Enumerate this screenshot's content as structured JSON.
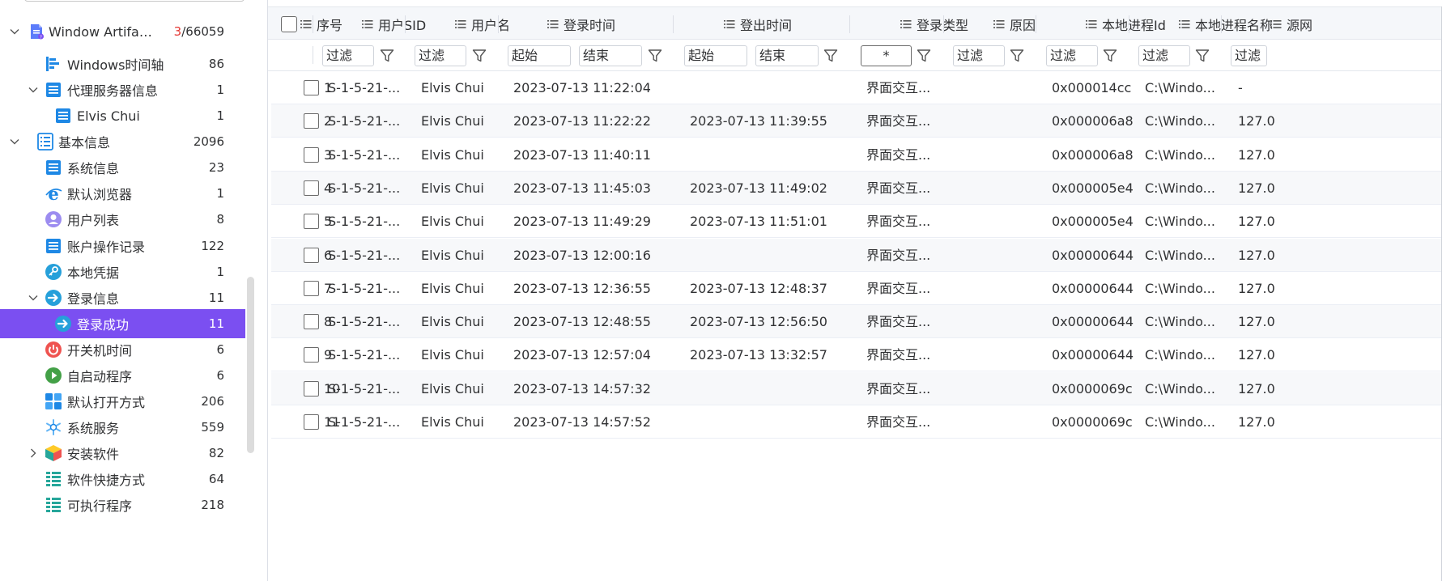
{
  "sidebar": {
    "items": [
      {
        "label": "Window Artifacts....",
        "count_highlight": "3",
        "count_rest": "/66059",
        "icon": "windows-artifacts-icon",
        "expand": "expanded",
        "level": 0
      },
      {
        "label": "Windows时间轴",
        "count": "86",
        "icon": "timeline-icon",
        "expand": "none",
        "level": 1
      },
      {
        "label": "代理服务器信息",
        "count": "1",
        "icon": "list-doc-icon",
        "expand": "expanded",
        "level": 1
      },
      {
        "label": "Elvis Chui",
        "count": "1",
        "icon": "list-doc-icon",
        "expand": "none",
        "level": 2
      },
      {
        "label": "基本信息",
        "count": "2096",
        "icon": "basic-info-icon",
        "expand": "expanded",
        "level": 0
      },
      {
        "label": "系统信息",
        "count": "23",
        "icon": "list-doc-icon",
        "expand": "none",
        "level": 1
      },
      {
        "label": "默认浏览器",
        "count": "1",
        "icon": "ie-browser-icon",
        "expand": "none",
        "level": 1
      },
      {
        "label": "用户列表",
        "count": "8",
        "icon": "user-icon",
        "expand": "none",
        "level": 1
      },
      {
        "label": "账户操作记录",
        "count": "122",
        "icon": "list-doc-icon",
        "expand": "none",
        "level": 1
      },
      {
        "label": "本地凭据",
        "count": "1",
        "icon": "key-icon",
        "expand": "none",
        "level": 1
      },
      {
        "label": "登录信息",
        "count": "11",
        "icon": "login-arrow-icon",
        "expand": "expanded",
        "level": 1
      },
      {
        "label": "登录成功",
        "count": "11",
        "icon": "login-arrow-icon",
        "expand": "none",
        "level": 2,
        "active": true
      },
      {
        "label": "开关机时间",
        "count": "6",
        "icon": "power-icon",
        "expand": "none",
        "level": 1
      },
      {
        "label": "自启动程序",
        "count": "6",
        "icon": "play-icon",
        "expand": "none",
        "level": 1
      },
      {
        "label": "默认打开方式",
        "count": "206",
        "icon": "apps-grid-icon",
        "expand": "none",
        "level": 1
      },
      {
        "label": "系统服务",
        "count": "559",
        "icon": "gear-snowflake-icon",
        "expand": "none",
        "level": 1
      },
      {
        "label": "安装软件",
        "count": "82",
        "icon": "package-box-icon",
        "expand": "collapsed",
        "level": 1
      },
      {
        "label": "软件快捷方式",
        "count": "64",
        "icon": "shortcut-list-icon",
        "expand": "none",
        "level": 1
      },
      {
        "label": "可执行程序",
        "count": "218",
        "icon": "shortcut-list-icon",
        "expand": "none",
        "level": 1
      }
    ]
  },
  "columns": [
    {
      "key": "seq",
      "label": "序号"
    },
    {
      "key": "sid",
      "label": "用户SID"
    },
    {
      "key": "user",
      "label": "用户名"
    },
    {
      "key": "login",
      "label": "登录时间"
    },
    {
      "key": "logout",
      "label": "登出时间"
    },
    {
      "key": "type",
      "label": "登录类型"
    },
    {
      "key": "reason",
      "label": "原因"
    },
    {
      "key": "pid",
      "label": "本地进程Id"
    },
    {
      "key": "pname",
      "label": "本地进程名称"
    },
    {
      "key": "src",
      "label": "源网"
    }
  ],
  "filters": {
    "sid": "过滤",
    "user": "过滤",
    "login_start": "起始",
    "login_end": "结束",
    "logout_start": "起始",
    "logout_end": "结束",
    "type": "*",
    "reason": "过滤",
    "pid": "过滤",
    "pname": "过滤",
    "src": "过滤"
  },
  "rows": [
    {
      "seq": "1",
      "sid": "S-1-5-21-...",
      "user": "Elvis Chui",
      "login": "2023-07-13 11:22:04",
      "logout": "",
      "type": "界面交互...",
      "reason": "",
      "pid": "0x000014cc",
      "pname": "C:\\Windo...",
      "src": "-"
    },
    {
      "seq": "2",
      "sid": "S-1-5-21-...",
      "user": "Elvis Chui",
      "login": "2023-07-13 11:22:22",
      "logout": "2023-07-13 11:39:55",
      "type": "界面交互...",
      "reason": "",
      "pid": "0x000006a8",
      "pname": "C:\\Windo...",
      "src": "127.0"
    },
    {
      "seq": "3",
      "sid": "S-1-5-21-...",
      "user": "Elvis Chui",
      "login": "2023-07-13 11:40:11",
      "logout": "",
      "type": "界面交互...",
      "reason": "",
      "pid": "0x000006a8",
      "pname": "C:\\Windo...",
      "src": "127.0"
    },
    {
      "seq": "4",
      "sid": "S-1-5-21-...",
      "user": "Elvis Chui",
      "login": "2023-07-13 11:45:03",
      "logout": "2023-07-13 11:49:02",
      "type": "界面交互...",
      "reason": "",
      "pid": "0x000005e4",
      "pname": "C:\\Windo...",
      "src": "127.0"
    },
    {
      "seq": "5",
      "sid": "S-1-5-21-...",
      "user": "Elvis Chui",
      "login": "2023-07-13 11:49:29",
      "logout": "2023-07-13 11:51:01",
      "type": "界面交互...",
      "reason": "",
      "pid": "0x000005e4",
      "pname": "C:\\Windo...",
      "src": "127.0"
    },
    {
      "seq": "6",
      "sid": "S-1-5-21-...",
      "user": "Elvis Chui",
      "login": "2023-07-13 12:00:16",
      "logout": "",
      "type": "界面交互...",
      "reason": "",
      "pid": "0x00000644",
      "pname": "C:\\Windo...",
      "src": "127.0"
    },
    {
      "seq": "7",
      "sid": "S-1-5-21-...",
      "user": "Elvis Chui",
      "login": "2023-07-13 12:36:55",
      "logout": "2023-07-13 12:48:37",
      "type": "界面交互...",
      "reason": "",
      "pid": "0x00000644",
      "pname": "C:\\Windo...",
      "src": "127.0"
    },
    {
      "seq": "8",
      "sid": "S-1-5-21-...",
      "user": "Elvis Chui",
      "login": "2023-07-13 12:48:55",
      "logout": "2023-07-13 12:56:50",
      "type": "界面交互...",
      "reason": "",
      "pid": "0x00000644",
      "pname": "C:\\Windo...",
      "src": "127.0"
    },
    {
      "seq": "9",
      "sid": "S-1-5-21-...",
      "user": "Elvis Chui",
      "login": "2023-07-13 12:57:04",
      "logout": "2023-07-13 13:32:57",
      "type": "界面交互...",
      "reason": "",
      "pid": "0x00000644",
      "pname": "C:\\Windo...",
      "src": "127.0"
    },
    {
      "seq": "10",
      "sid": "S-1-5-21-...",
      "user": "Elvis Chui",
      "login": "2023-07-13 14:57:32",
      "logout": "",
      "type": "界面交互...",
      "reason": "",
      "pid": "0x0000069c",
      "pname": "C:\\Windo...",
      "src": "127.0"
    },
    {
      "seq": "11",
      "sid": "S-1-5-21-...",
      "user": "Elvis Chui",
      "login": "2023-07-13 14:57:52",
      "logout": "",
      "type": "界面交互...",
      "reason": "",
      "pid": "0x0000069c",
      "pname": "C:\\Windo...",
      "src": "127.0"
    }
  ],
  "colors": {
    "accent": "#7b4ff1",
    "icon_blue": "#1e88e5",
    "count_red": "#e53935"
  }
}
